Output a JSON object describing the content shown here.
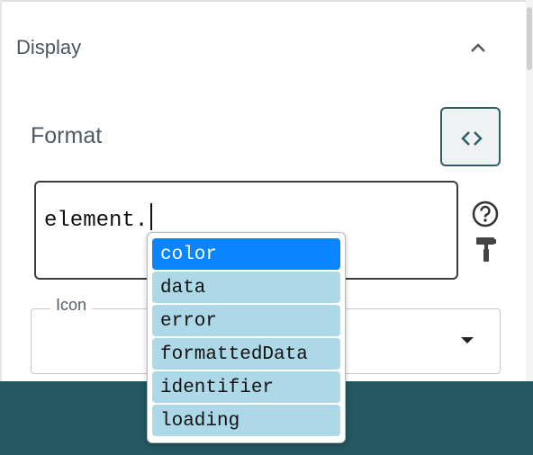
{
  "section": {
    "title": "Display",
    "collapse_icon": "chevron-up-icon"
  },
  "format": {
    "label": "Format",
    "value": "element.",
    "code_toggle_icon": "code-brackets-icon",
    "help_icon": "help-circle-icon",
    "format_paint_icon": "paint-roller-icon"
  },
  "icon_select": {
    "label": "Icon",
    "value": "",
    "arrow_icon": "dropdown-arrow-icon"
  },
  "autocomplete": {
    "items": [
      "color",
      "data",
      "error",
      "formattedData",
      "identifier",
      "loading"
    ],
    "selected_index": 0
  },
  "colors": {
    "accent": "#255863",
    "selected": "#0a84ff",
    "suggestion_bg": "#acd8e7"
  }
}
